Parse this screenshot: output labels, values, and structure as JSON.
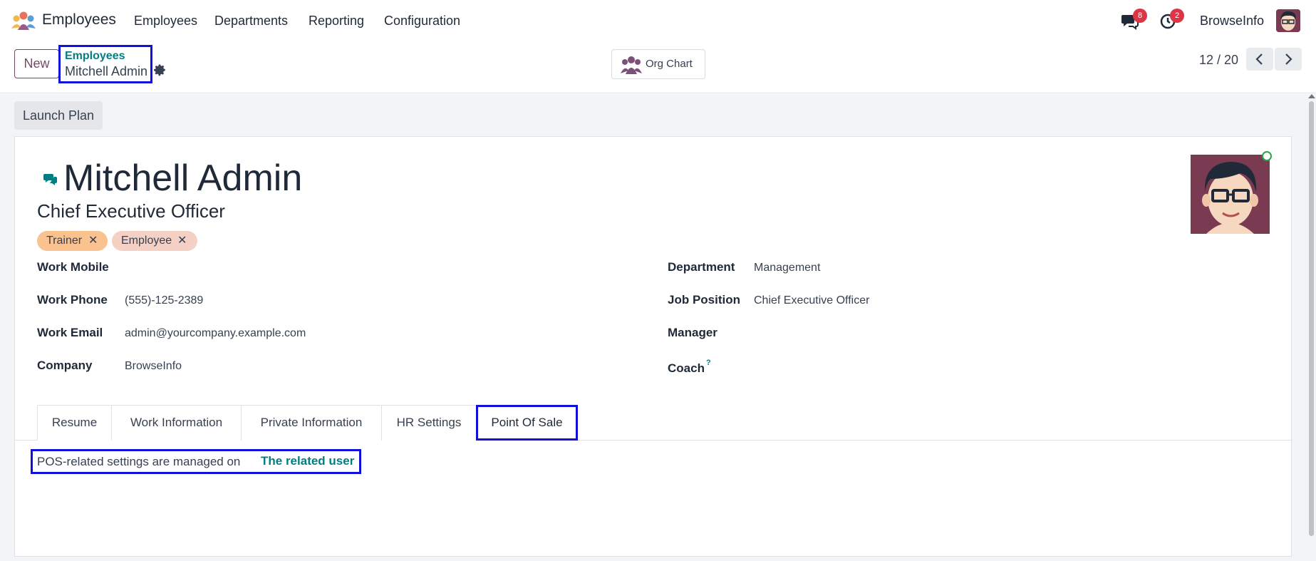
{
  "nav": {
    "app_name": "Employees",
    "menu": [
      "Employees",
      "Departments",
      "Reporting",
      "Configuration"
    ],
    "messages_count": "8",
    "activities_count": "2",
    "company": "BrowseInfo"
  },
  "control": {
    "new_label": "New",
    "breadcrumb_parent": "Employees",
    "breadcrumb_current": "Mitchell Admin",
    "org_chart_label": "Org Chart",
    "pager": "12 / 20"
  },
  "actions": {
    "launch_plan": "Launch Plan"
  },
  "employee": {
    "name": "Mitchell Admin",
    "job_title": "Chief Executive Officer",
    "tags": [
      {
        "label": "Trainer",
        "color": "#f9c28e"
      },
      {
        "label": "Employee",
        "color": "#f5d0c5"
      }
    ]
  },
  "fields_left": [
    {
      "label": "Work Mobile",
      "value": ""
    },
    {
      "label": "Work Phone",
      "value": "(555)-125-2389"
    },
    {
      "label": "Work Email",
      "value": "admin@yourcompany.example.com"
    },
    {
      "label": "Company",
      "value": "BrowseInfo"
    }
  ],
  "fields_right": [
    {
      "label": "Department",
      "value": "Management"
    },
    {
      "label": "Job Position",
      "value": "Chief Executive Officer"
    },
    {
      "label": "Manager",
      "value": ""
    },
    {
      "label": "Coach",
      "value": "",
      "help": "?"
    }
  ],
  "tabs": [
    {
      "label": "Resume",
      "active": false
    },
    {
      "label": "Work Information",
      "active": false
    },
    {
      "label": "Private Information",
      "active": false
    },
    {
      "label": "HR Settings",
      "active": false
    },
    {
      "label": "Point Of Sale",
      "active": true
    }
  ],
  "pos": {
    "text": "POS-related settings are managed on",
    "link": "The related user"
  },
  "colors": {
    "brand": "#714b67",
    "link": "#017e84",
    "highlight": "#1010d8",
    "badge": "#dc3545"
  }
}
